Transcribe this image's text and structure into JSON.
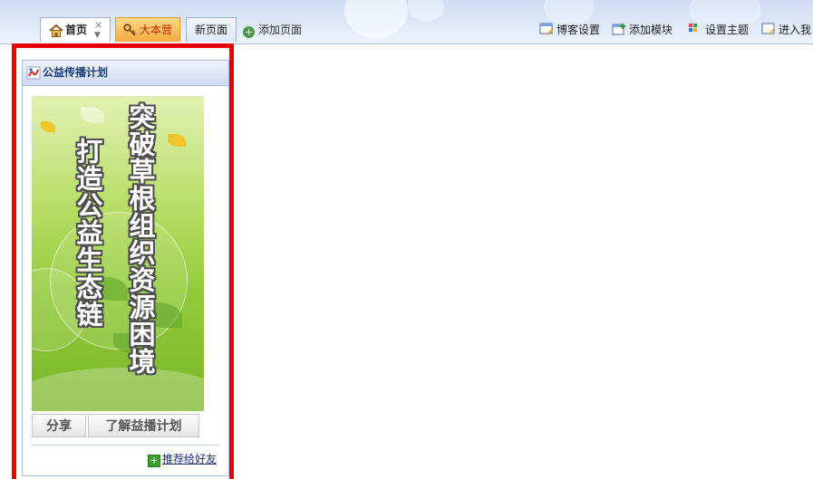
{
  "tabs": [
    {
      "label": "首页",
      "icon": "house-icon",
      "close": "×",
      "menu": "▼"
    },
    {
      "label": "大本营",
      "icon": "key-icon"
    },
    {
      "label": "新页面"
    }
  ],
  "add_page": {
    "icon": "add-circle-icon",
    "label": "添加页面"
  },
  "toolbar": [
    {
      "icon": "blog-settings-icon",
      "label": "博客设置"
    },
    {
      "icon": "add-module-icon",
      "label": "添加模块"
    },
    {
      "icon": "theme-icon",
      "label": "设置主题"
    },
    {
      "icon": "enter-icon",
      "label": "进入我"
    }
  ],
  "module": {
    "title": "公益传播计划",
    "icon": "module-logo-icon",
    "poster": {
      "line1": "突破草根组织资源困境",
      "line2": "打造公益生态链"
    },
    "buttons": {
      "share": "分享",
      "learn": "了解益播计划"
    },
    "recommend": {
      "icon": "plus-square-icon",
      "label": "推荐给好友"
    }
  },
  "colors": {
    "highlight_border": "#e70000",
    "accent_tab": "#f7a93a",
    "link": "#1d2f7d"
  }
}
